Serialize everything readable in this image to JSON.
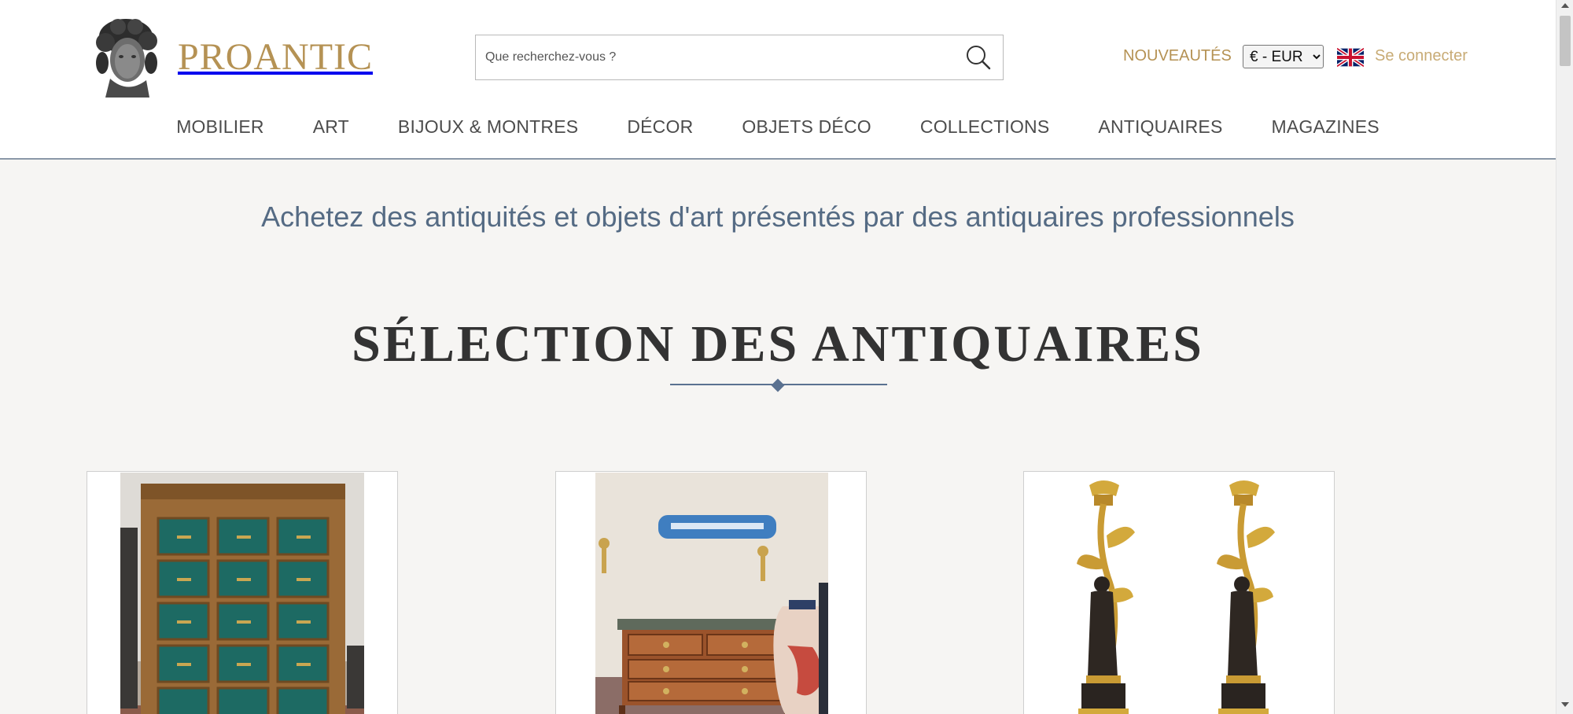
{
  "header": {
    "logo_text": "PROANTIC",
    "search_placeholder": "Que recherchez-vous ?",
    "nouveautes_label": "NOUVEAUTÉS",
    "currency_selected": "€ - EUR",
    "login_label": "Se connecter",
    "icons": {
      "search": "search-icon",
      "language": "uk-flag-icon",
      "logo": "bust-logo"
    }
  },
  "nav": {
    "items": [
      {
        "label": "MOBILIER"
      },
      {
        "label": "ART"
      },
      {
        "label": "BIJOUX & MONTRES"
      },
      {
        "label": "DÉCOR"
      },
      {
        "label": "OBJETS DÉCO"
      },
      {
        "label": "COLLECTIONS"
      },
      {
        "label": "ANTIQUAIRES"
      },
      {
        "label": "MAGAZINES"
      }
    ]
  },
  "hero": {
    "tagline": "Achetez des antiquités et objets d'art présentés par des antiquaires professionnels",
    "section_title": "SÉLECTION DES ANTIQUAIRES"
  },
  "products": [
    {
      "image": "filing-cabinet-photo"
    },
    {
      "image": "commode-photo"
    },
    {
      "image": "candelabra-pair-photo"
    }
  ],
  "colors": {
    "brand_gold": "#b59254",
    "tagline_blue": "#556b84",
    "accent_rule": "#5a7190",
    "page_bg": "#f6f5f3"
  }
}
